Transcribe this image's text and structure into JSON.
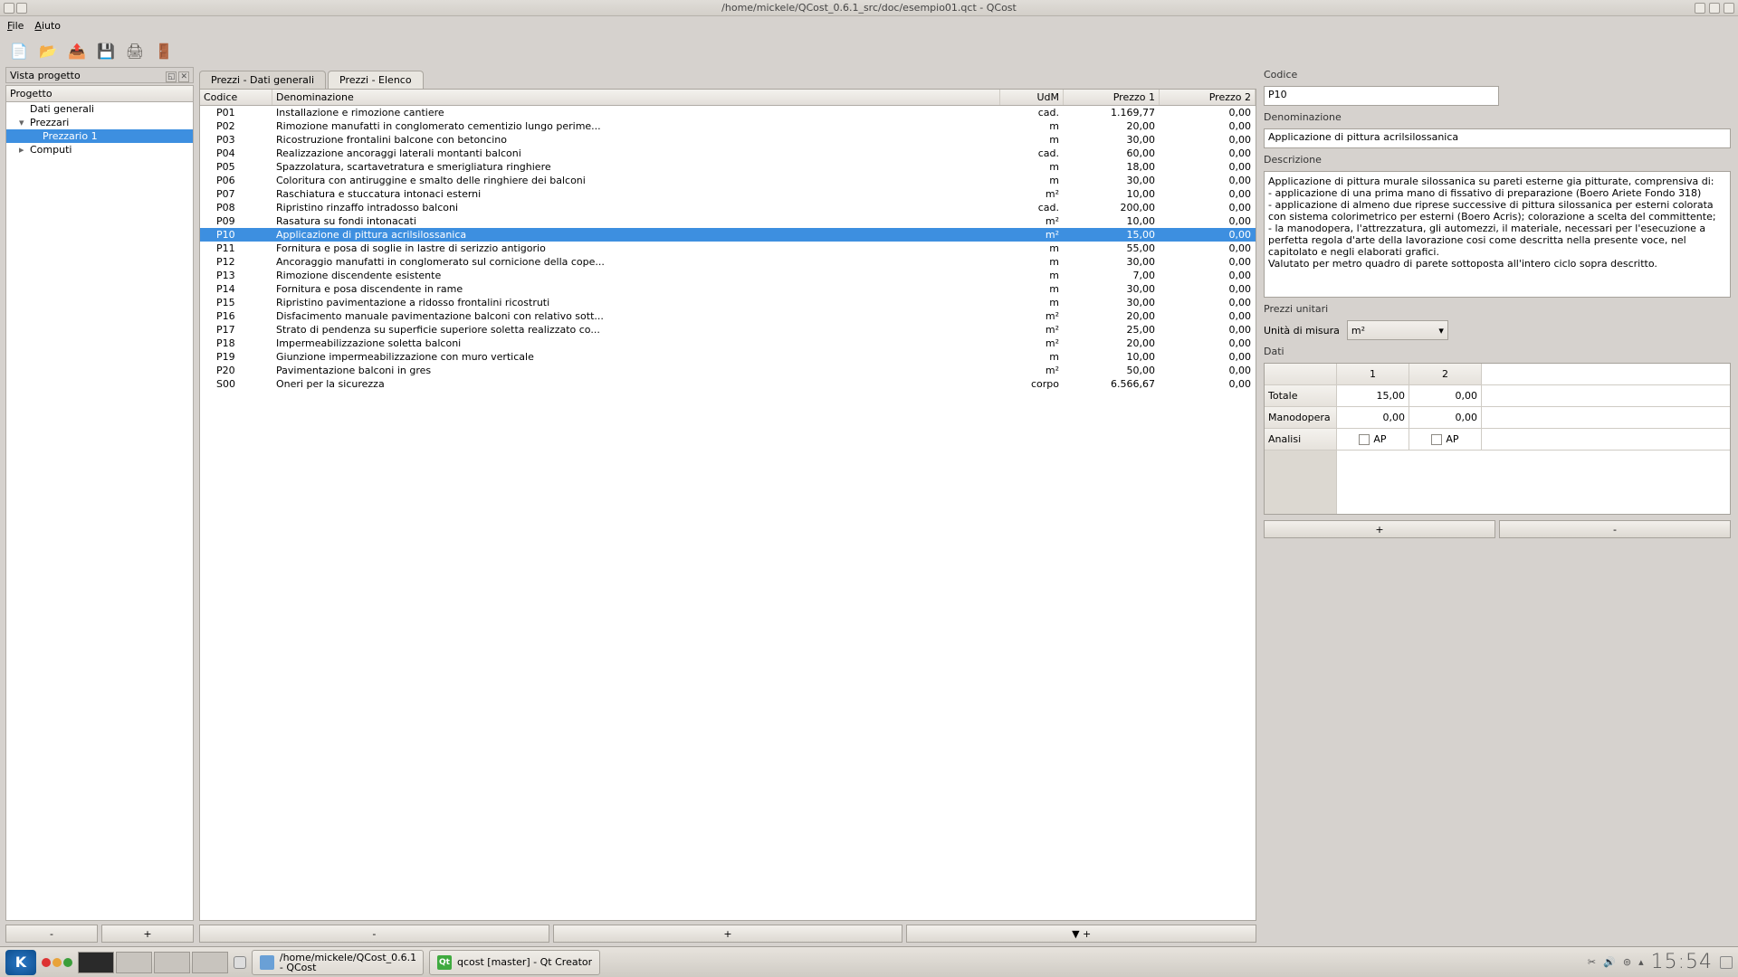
{
  "window": {
    "title": "/home/mickele/QCost_0.6.1_src/doc/esempio01.qct - QCost"
  },
  "menu": {
    "file": "File",
    "help": "Aiuto"
  },
  "dock": {
    "title": "Vista progetto",
    "header": "Progetto"
  },
  "tree": {
    "dati_generali": "Dati generali",
    "prezzari": "Prezzari",
    "prezzario1": "Prezzario 1",
    "computi": "Computi"
  },
  "left_buttons": {
    "minus": "-",
    "plus": "+"
  },
  "tabs": {
    "dati_generali": "Prezzi - Dati generali",
    "elenco": "Prezzi - Elenco"
  },
  "price_headers": {
    "codice": "Codice",
    "denominazione": "Denominazione",
    "udm": "UdM",
    "prezzo1": "Prezzo 1",
    "prezzo2": "Prezzo 2"
  },
  "prices": [
    {
      "code": "P01",
      "den": "Installazione e rimozione cantiere",
      "udm": "cad.",
      "p1": "1.169,77",
      "p2": "0,00"
    },
    {
      "code": "P02",
      "den": "Rimozione manufatti in conglomerato cementizio lungo perime...",
      "udm": "m",
      "p1": "20,00",
      "p2": "0,00"
    },
    {
      "code": "P03",
      "den": "Ricostruzione frontalini balcone con betoncino",
      "udm": "m",
      "p1": "30,00",
      "p2": "0,00"
    },
    {
      "code": "P04",
      "den": "Realizzazione ancoraggi laterali montanti balconi",
      "udm": "cad.",
      "p1": "60,00",
      "p2": "0,00"
    },
    {
      "code": "P05",
      "den": "Spazzolatura, scartavetratura e smerigliatura ringhiere",
      "udm": "m",
      "p1": "18,00",
      "p2": "0,00"
    },
    {
      "code": "P06",
      "den": "Coloritura con antiruggine e smalto delle ringhiere dei balconi",
      "udm": "m",
      "p1": "30,00",
      "p2": "0,00"
    },
    {
      "code": "P07",
      "den": "Raschiatura e stuccatura intonaci esterni",
      "udm": "m²",
      "p1": "10,00",
      "p2": "0,00"
    },
    {
      "code": "P08",
      "den": "Ripristino rinzaffo intradosso balconi",
      "udm": "cad.",
      "p1": "200,00",
      "p2": "0,00"
    },
    {
      "code": "P09",
      "den": "Rasatura su fondi intonacati",
      "udm": "m²",
      "p1": "10,00",
      "p2": "0,00"
    },
    {
      "code": "P10",
      "den": "Applicazione di pittura acrilsilossanica",
      "udm": "m²",
      "p1": "15,00",
      "p2": "0,00"
    },
    {
      "code": "P11",
      "den": "Fornitura e posa di soglie in lastre di serizzio antigorio",
      "udm": "m",
      "p1": "55,00",
      "p2": "0,00"
    },
    {
      "code": "P12",
      "den": "Ancoraggio manufatti in conglomerato sul cornicione della cope...",
      "udm": "m",
      "p1": "30,00",
      "p2": "0,00"
    },
    {
      "code": "P13",
      "den": "Rimozione discendente esistente",
      "udm": "m",
      "p1": "7,00",
      "p2": "0,00"
    },
    {
      "code": "P14",
      "den": "Fornitura e posa discendente in rame",
      "udm": "m",
      "p1": "30,00",
      "p2": "0,00"
    },
    {
      "code": "P15",
      "den": "Ripristino pavimentazione a ridosso frontalini ricostruti",
      "udm": "m",
      "p1": "30,00",
      "p2": "0,00"
    },
    {
      "code": "P16",
      "den": "Disfacimento manuale pavimentazione balconi con relativo sott...",
      "udm": "m²",
      "p1": "20,00",
      "p2": "0,00"
    },
    {
      "code": "P17",
      "den": "Strato di pendenza su superficie superiore soletta realizzato co...",
      "udm": "m²",
      "p1": "25,00",
      "p2": "0,00"
    },
    {
      "code": "P18",
      "den": "Impermeabilizzazione soletta balconi",
      "udm": "m²",
      "p1": "20,00",
      "p2": "0,00"
    },
    {
      "code": "P19",
      "den": "Giunzione impermeabilizzazione con muro verticale",
      "udm": "m",
      "p1": "10,00",
      "p2": "0,00"
    },
    {
      "code": "P20",
      "den": "Pavimentazione balconi in gres",
      "udm": "m²",
      "p1": "50,00",
      "p2": "0,00"
    },
    {
      "code": "S00",
      "den": "Oneri per la sicurezza",
      "udm": "corpo",
      "p1": "6.566,67",
      "p2": "0,00"
    }
  ],
  "center_buttons": {
    "minus": "-",
    "plus": "+",
    "downplus": "▼ +"
  },
  "detail": {
    "codice_lbl": "Codice",
    "codice_val": "P10",
    "denom_lbl": "Denominazione",
    "denom_val": "Applicazione di pittura acrilsilossanica",
    "descr_lbl": "Descrizione",
    "descr_val": "Applicazione di pittura murale silossanica su pareti esterne gia pitturate, comprensiva di:\n- applicazione di una prima mano di fissativo di preparazione (Boero Ariete Fondo 318)\n- applicazione di almeno due riprese successive di pittura silossanica per esterni colorata con sistema colorimetrico per esterni (Boero Acris); colorazione a scelta del committente;\n- la manodopera, l'attrezzatura, gli automezzi, il materiale, necessari per l'esecuzione a perfetta regola d'arte della lavorazione cosi come descritta nella presente voce, nel capitolato e negli elaborati grafici.\nValutato per metro quadro di parete sottoposta all'intero ciclo sopra descritto.",
    "pu_lbl": "Prezzi unitari",
    "um_lbl": "Unità di misura",
    "um_val": "m²",
    "dati_lbl": "Dati",
    "col1": "1",
    "col2": "2",
    "totale": "Totale",
    "totale1": "15,00",
    "totale2": "0,00",
    "mano": "Manodopera",
    "mano1": "0,00",
    "mano2": "0,00",
    "analisi": "Analisi",
    "ap": "AP",
    "plus": "+",
    "minus": "-"
  },
  "taskbar": {
    "task1_line1": "/home/mickele/QCost_0.6.1",
    "task1_line2": "- QCost",
    "task2": "qcost [master] - Qt Creator",
    "clock": "15:54"
  }
}
